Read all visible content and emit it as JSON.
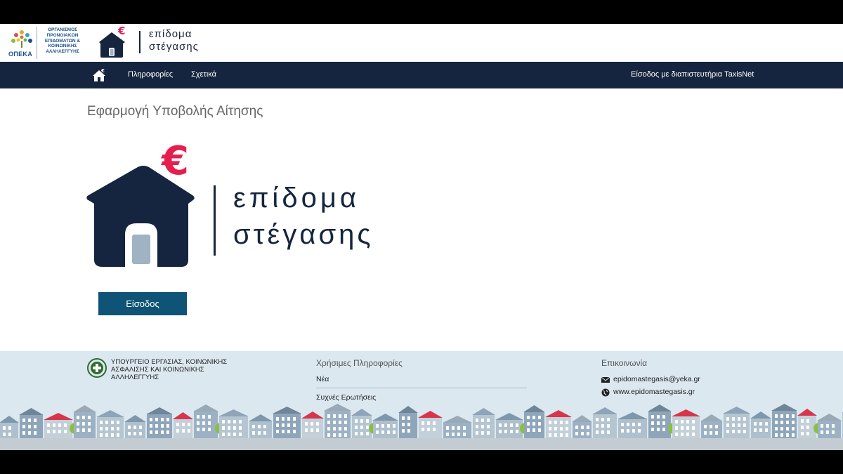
{
  "header": {
    "org_logo_name": "ΟΠΕΚΑ",
    "org_logo_text": "ΟΡΓΑΝΙΣΜΟΣ ΠΡΟΝΟΙΑΚΩΝ ΕΠΙΔΟΜΑΤΩΝ & ΚΟΙΝΩΝΙΚΗΣ ΑΛΛΗΛΕΓΓΥΗΣ",
    "brand_line1": "επίδομα",
    "brand_line2": "στέγασης"
  },
  "navbar": {
    "home_icon": "home-icon",
    "items": [
      {
        "label": "Πληροφορίες"
      },
      {
        "label": "Σχετικά"
      }
    ],
    "login_label": "Είσοδος με διαπιστευτήρια TaxisNet"
  },
  "main": {
    "title": "Εφαρμογή Υποβολής Αίτησης",
    "hero_line1": "επίδομα",
    "hero_line2": "στέγασης",
    "login_button": "Είσοδος"
  },
  "footer": {
    "ministry": "ΥΠΟΥΡΓΕΙΟ ΕΡΓΑΣΙΑΣ, ΚΟΙΝΩΝΙΚΗΣ ΑΣΦΑΛΙΣΗΣ ΚΑΙ ΚΟΙΝΩΝΙΚΗΣ ΑΛΛΗΛΕΓΓΥΗΣ",
    "useful_title": "Χρήσιμες Πληροφορίες",
    "useful_links": [
      {
        "label": "Νέα"
      },
      {
        "label": "Συχνές Ερωτήσεις"
      }
    ],
    "contact_title": "Επικοινωνία",
    "email": "epidomastegasis@yeka.gr",
    "website": "www.epidomastegasis.gr"
  },
  "colors": {
    "navy": "#15253f",
    "euro_red": "#e61e4d",
    "button_blue": "#0f5476",
    "footer_bg": "#dbe8f0"
  }
}
